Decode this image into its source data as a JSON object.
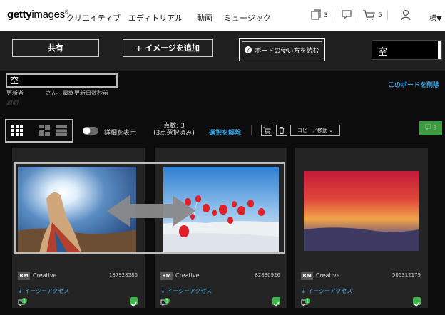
{
  "header": {
    "logo_bold": "getty",
    "logo_light": "images",
    "logo_mark": "®",
    "nav": [
      "クリエイティブ",
      "エディトリアル",
      "動画",
      "ミュージック"
    ],
    "boards_count": "3",
    "cart_count": "5",
    "user_label": "様▼"
  },
  "board_bar": {
    "share_label": "共有",
    "add_images_label": "+ イメージを追加",
    "howto_label": "ボードの使い方を読む",
    "board_selector_value": "空"
  },
  "board": {
    "title": "空",
    "owner_label": "更新者",
    "updated_text": "さん、最終更新日数秒前",
    "description": "説明",
    "delete_label": "このボードを削除"
  },
  "toolbar": {
    "details_label": "詳細を表示",
    "count_text": "点数: 3",
    "selected_text": "(3点選択済み)",
    "deselect_label": "選択を解除",
    "copy_move_label": "コピー／移動 ⌄",
    "comments_count": "3"
  },
  "cards": [
    {
      "license": "RM",
      "collection": "Creative",
      "id": "187928586",
      "access": "イージーアクセス",
      "comments": "1"
    },
    {
      "license": "RM",
      "collection": "Creative",
      "id": "82830926",
      "access": "イージーアクセス",
      "comments": "1"
    },
    {
      "license": "RM",
      "collection": "Creative",
      "id": "505312179",
      "access": "イージーアクセス",
      "comments": "1"
    }
  ],
  "colors": {
    "accent_blue": "#3aa6e6",
    "success_green": "#3cb54a",
    "band": "#202020"
  }
}
